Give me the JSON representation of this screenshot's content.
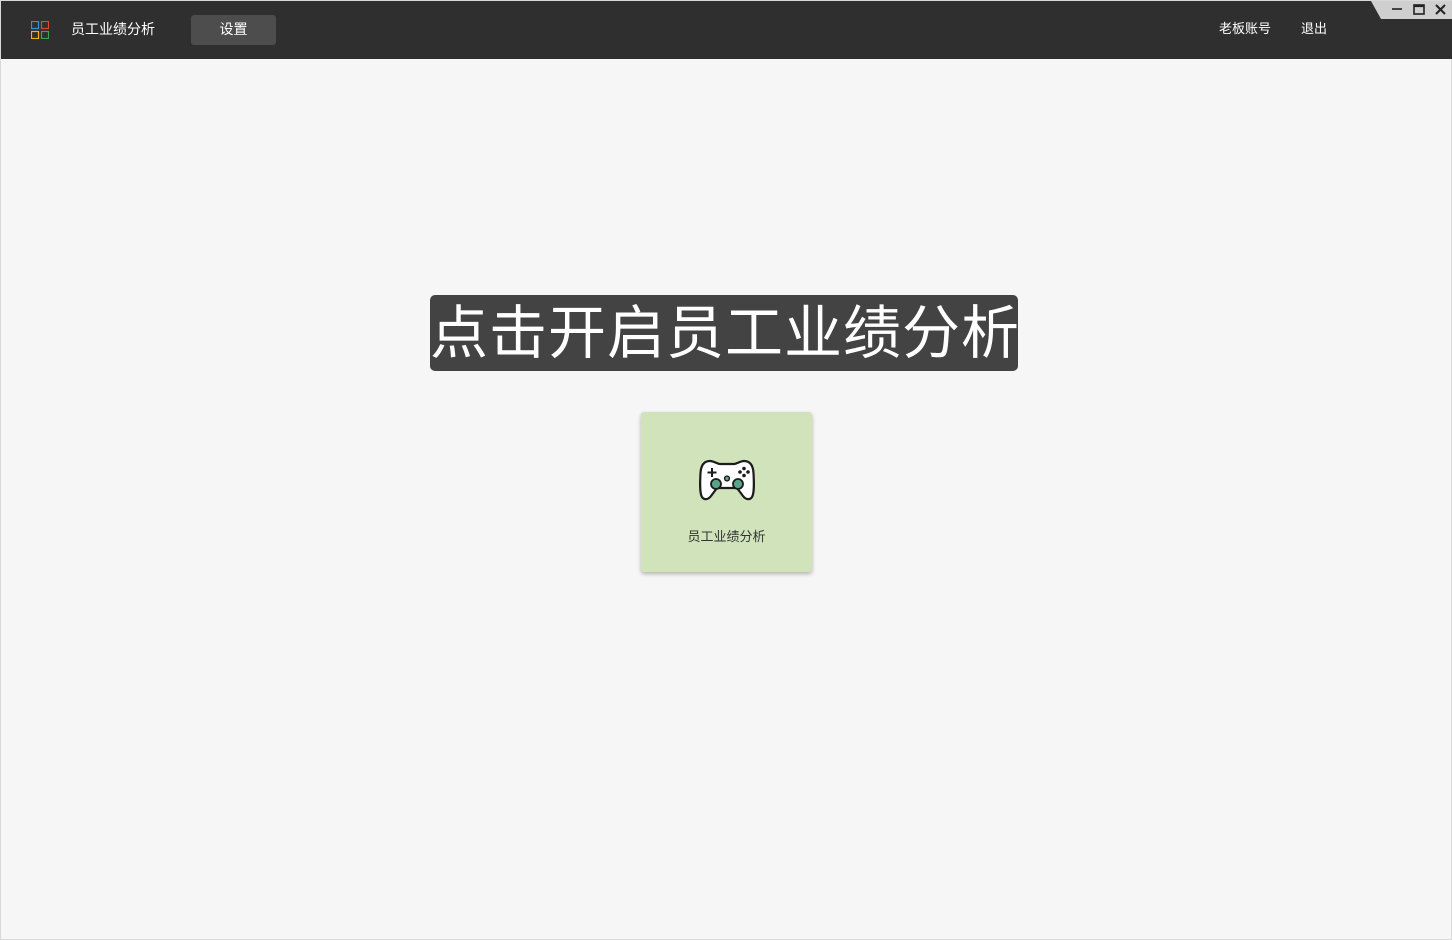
{
  "header": {
    "app_title": "员工业绩分析",
    "settings_label": "设置",
    "account_label": "老板账号",
    "logout_label": "退出"
  },
  "window_controls": {
    "minimize_icon": "minimize-icon",
    "maximize_icon": "maximize-icon",
    "close_icon": "close-icon"
  },
  "main": {
    "headline": "点击开启员工业绩分析",
    "tile": {
      "label": "员工业绩分析",
      "icon": "gamepad-icon",
      "background": "#d0e3bb"
    }
  },
  "colors": {
    "titlebar": "#2f2f2f",
    "headline_bg": "#434343",
    "logo_squares": [
      "#3b8fd9",
      "#e0492e",
      "#f0b21c",
      "#35a853"
    ]
  }
}
